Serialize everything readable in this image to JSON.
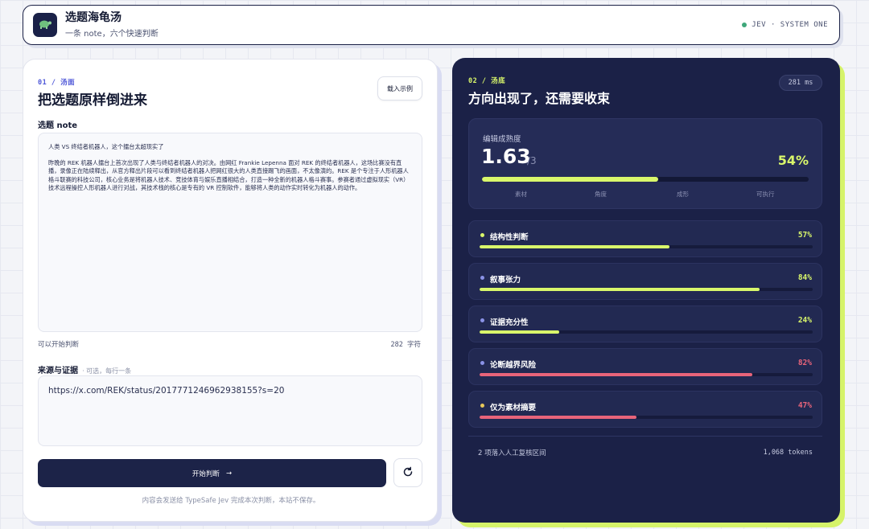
{
  "header": {
    "title": "选题海龟汤",
    "subtitle": "一条 note，六个快速判断",
    "status_text": "JEV · SYSTEM ONE",
    "logo_icon": "turtle-icon"
  },
  "left": {
    "step": "01  /  汤面",
    "title": "把选题原样倒进来",
    "example_button": "载入示例",
    "note_label": "选题 note",
    "note_paragraphs": [
      "人类 VS 终结者机器人，这个擂台太超现实了",
      "昨晚的 REK 机器人擂台上首次出现了人类与终结者机器人的对决。由网红 Frankie Lepenna 面对 REK 的终结者机器人，这场比赛没有直播，录像正在陆续释出，从官方释出片段可以看到终结者机器人把网红很大的人类直接踢飞的画面，不太像演的。REK 是个专注于人形机器人格斗联赛的科技公司，核心业务是将机器人技术、竞技体育与娱乐直播相结合，打造一种全新的机器人格斗赛事。参赛者通过虚拟现实（VR）技术远程操控人形机器人进行对战，其技术栈的核心是专有的 VR 控制软件，能够将人类的动作实时转化为机器人的动作。"
    ],
    "ready_text": "可以开始判断",
    "char_count": "282 字符",
    "source_label": "来源与证据",
    "source_hint": "· 可选，每行一条",
    "source_value": "https://x.com/REK/status/2017771246962938155?s=20",
    "start_button": "开始判断",
    "start_arrow": "→",
    "footnote": "内容会发送给 TypeSafe Jev 完成本次判断，本站不保存。"
  },
  "right": {
    "step": "02  /  汤底",
    "title": "方向出现了，还需要收束",
    "timing": "281 ms",
    "score": {
      "label": "编辑成熟度",
      "value": "1.63",
      "max": "/3",
      "percent_text": "54%",
      "percent": 54,
      "stages": [
        "素材",
        "角度",
        "成形",
        "可执行"
      ]
    },
    "metrics": [
      {
        "name": "结构性判断",
        "percent_text": "57%",
        "percent": 57,
        "dot_color": "#d9f76b",
        "bar_color": "#d9f76b",
        "pct_color": "#d9f76b"
      },
      {
        "name": "叙事张力",
        "percent_text": "84%",
        "percent": 84,
        "dot_color": "#8a92e6",
        "bar_color": "#d9f76b",
        "pct_color": "#d9f76b"
      },
      {
        "name": "证据充分性",
        "percent_text": "24%",
        "percent": 24,
        "dot_color": "#8a92e6",
        "bar_color": "#d9f76b",
        "pct_color": "#d9f76b"
      },
      {
        "name": "论断越界风险",
        "percent_text": "82%",
        "percent": 82,
        "dot_color": "#8a92e6",
        "bar_color": "#e8647a",
        "pct_color": "#e8647a"
      },
      {
        "name": "仅为素材摘要",
        "percent_text": "47%",
        "percent": 47,
        "dot_color": "#e7c85a",
        "bar_color": "#e8647a",
        "pct_color": "#e8647a"
      }
    ],
    "footer_left": "2 项落入人工复核区间",
    "footer_right": "1,068 tokens"
  },
  "colors": {
    "accent_lime": "#d9f76b",
    "accent_red": "#e8647a",
    "navy": "#1b2147",
    "indigo": "#4f58d8"
  }
}
